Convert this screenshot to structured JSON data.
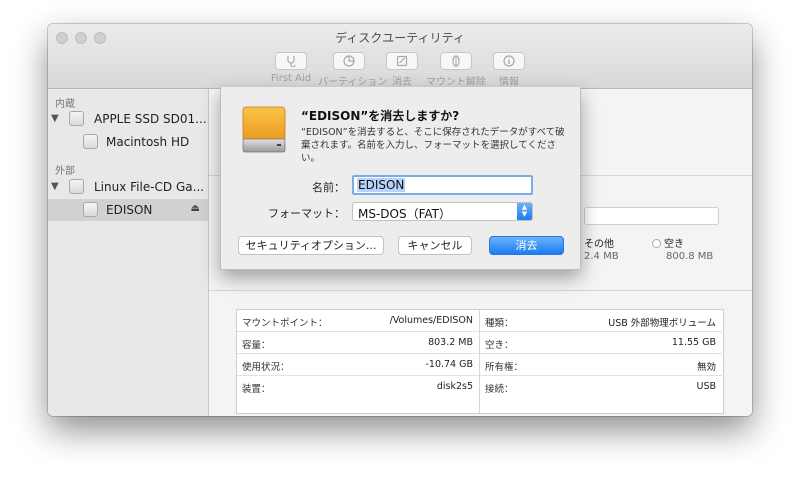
{
  "window": {
    "title": "ディスクユーティリティ"
  },
  "toolbar": {
    "first_aid": "First Aid",
    "partition": "パーティション",
    "erase": "消去",
    "unmount": "マウント解除",
    "info": "情報"
  },
  "sidebar": {
    "internal_header": "内蔵",
    "external_header": "外部",
    "items": [
      {
        "label": "APPLE SSD SD01..."
      },
      {
        "label": "Macintosh HD"
      },
      {
        "label": "Linux File-CD Ga..."
      },
      {
        "label": "EDISON"
      }
    ]
  },
  "usage": {
    "other_label": "その他",
    "other_value": "2.4 MB",
    "free_label": "空き",
    "free_value": "800.8 MB"
  },
  "info": {
    "left": [
      {
        "key": "マウントポイント：",
        "value": "/Volumes/EDISON"
      },
      {
        "key": "容量：",
        "value": "803.2 MB"
      },
      {
        "key": "使用状況：",
        "value": "-10.74 GB"
      },
      {
        "key": "装置：",
        "value": "disk2s5"
      }
    ],
    "right": [
      {
        "key": "種類：",
        "value": "USB 外部物理ボリューム"
      },
      {
        "key": "空き：",
        "value": "11.55 GB"
      },
      {
        "key": "所有権：",
        "value": "無効"
      },
      {
        "key": "接続：",
        "value": "USB"
      }
    ]
  },
  "sheet": {
    "title": "“EDISON”を消去しますか?",
    "message": "“EDISON”を消去すると、そこに保存されたデータがすべて破棄されます。名前を入力し、フォーマットを選択してください。",
    "name_label": "名前：",
    "name_value": "EDISON",
    "format_label": "フォーマット：",
    "format_value": "MS-DOS（FAT）",
    "security_button": "セキュリティオプション...",
    "cancel_button": "キャンセル",
    "erase_button": "消去"
  }
}
